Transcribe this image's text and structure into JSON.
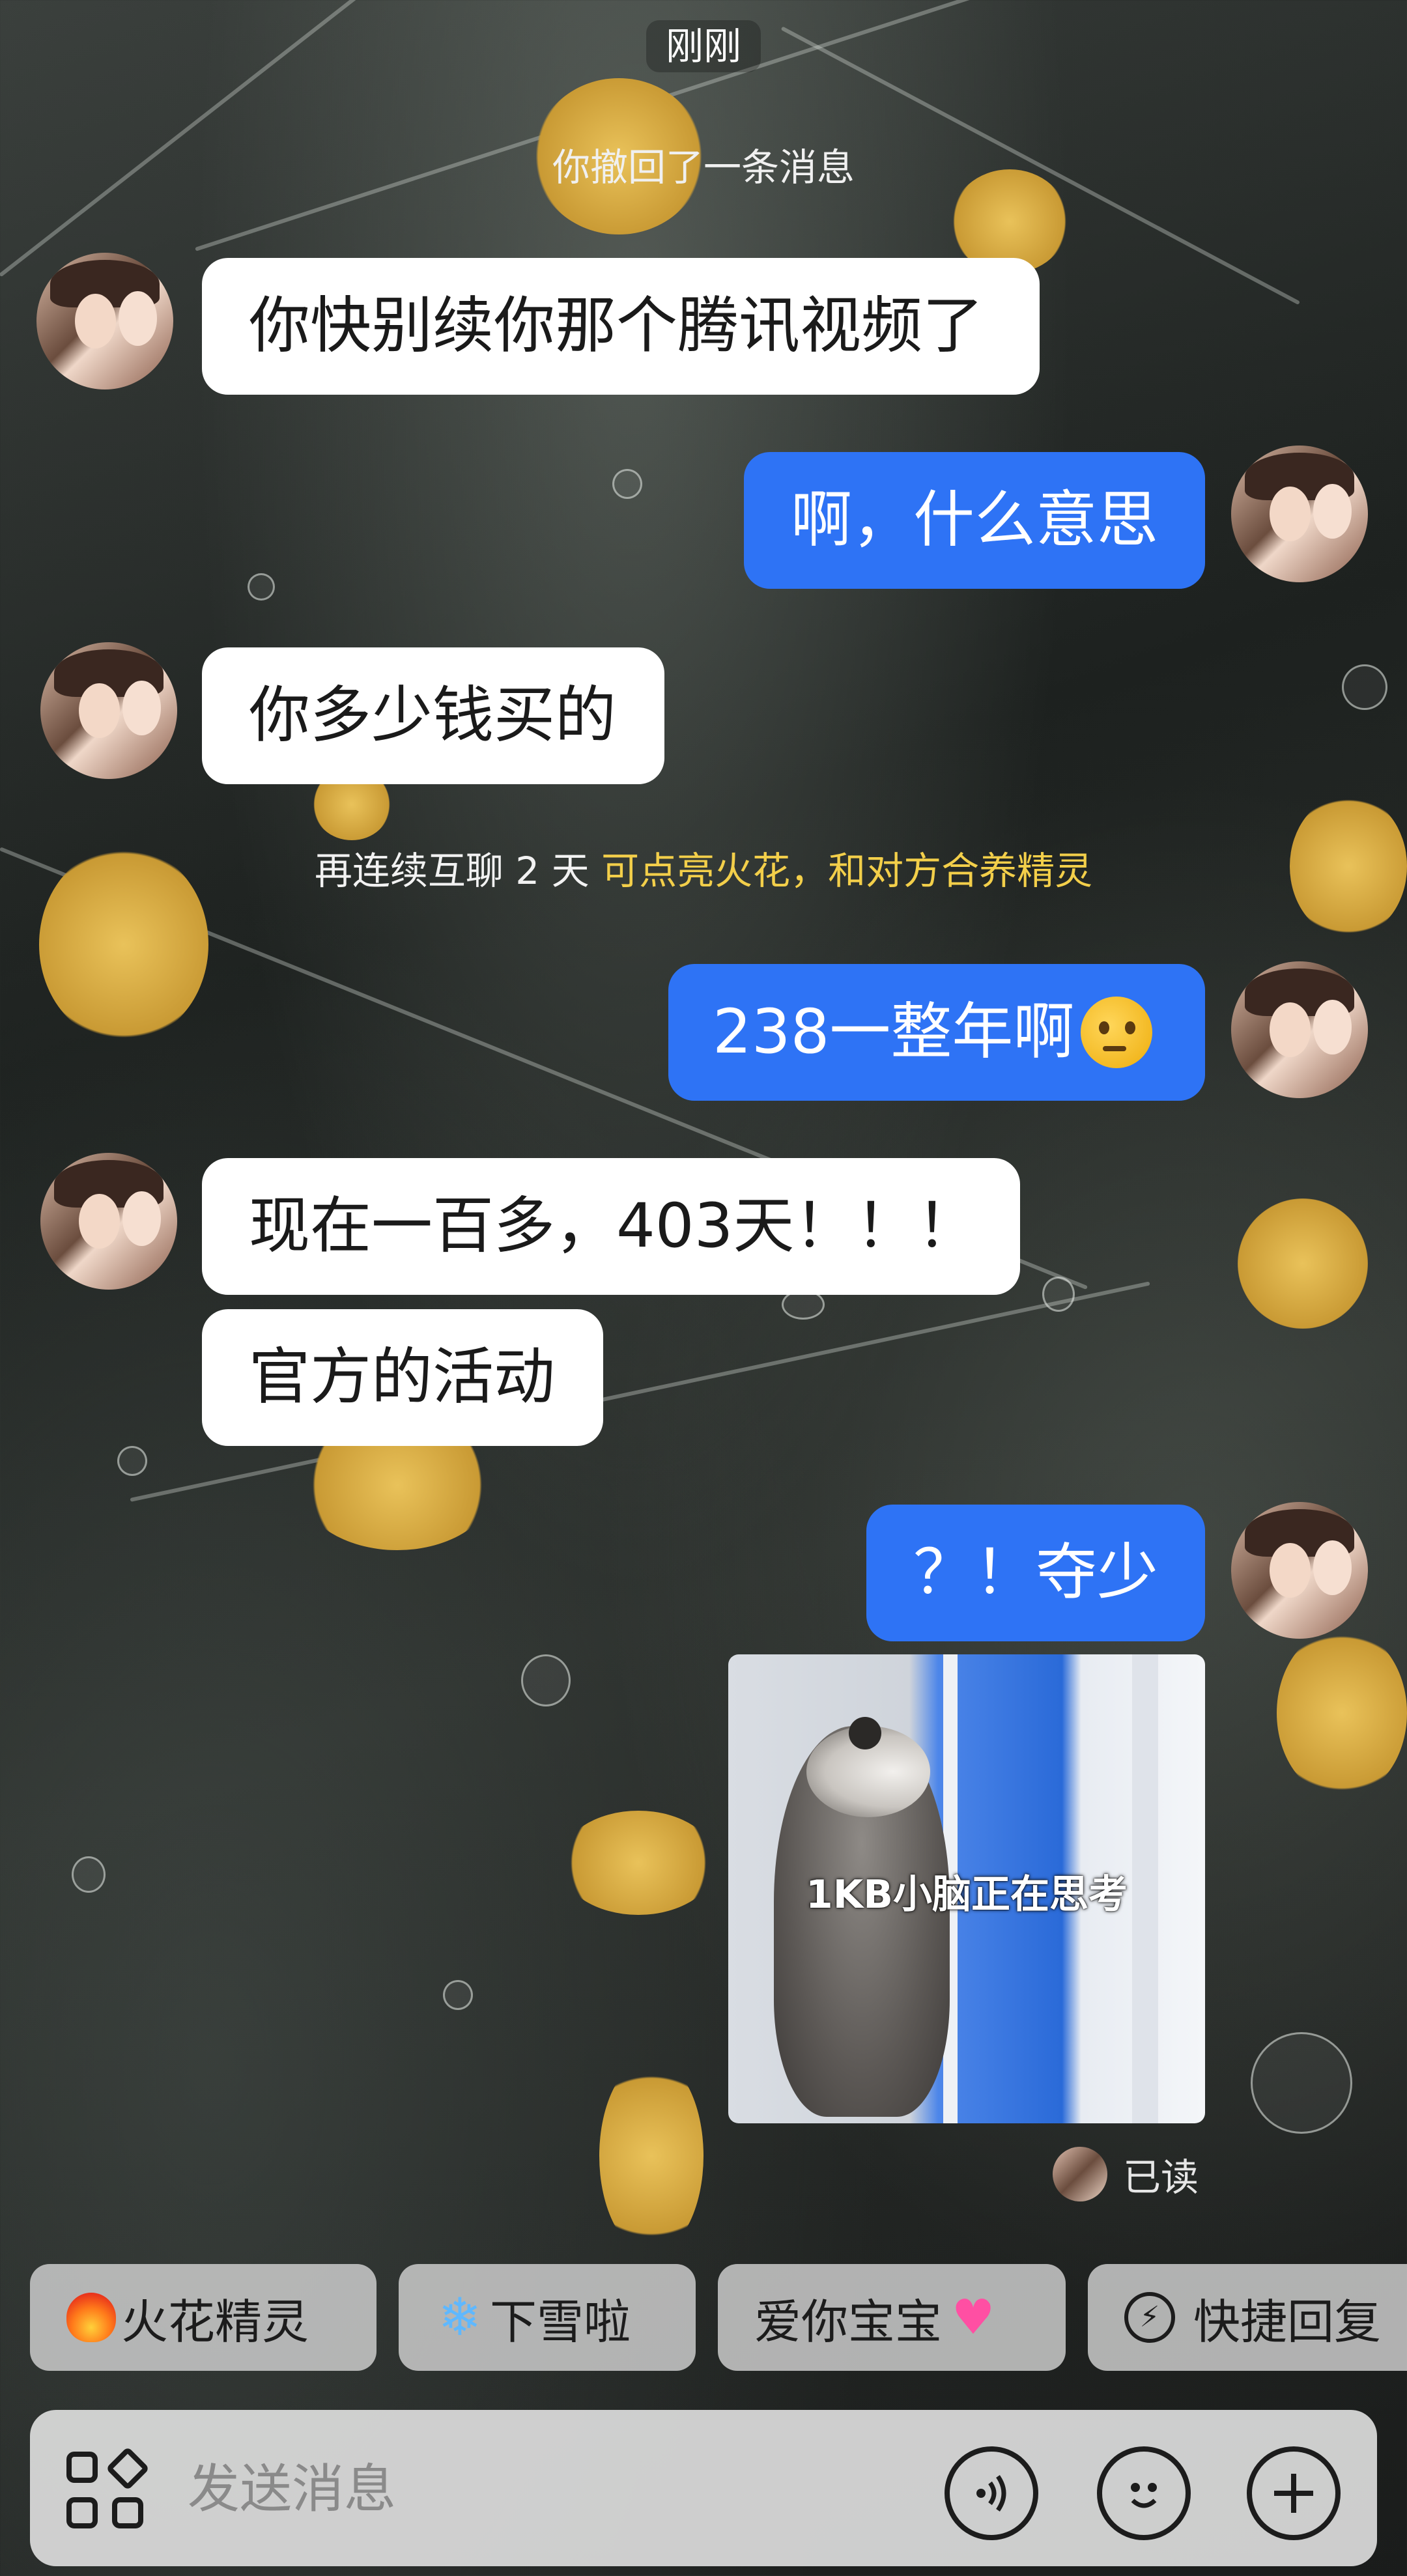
{
  "chat": {
    "time_divider": "刚刚",
    "recall_notice": "你撤回了一条消息",
    "streak_notice": {
      "prefix": "再连续互聊 2 天",
      "highlight": "可点亮火花，和对方合养精灵"
    },
    "messages": [
      {
        "from": "other",
        "text": "你快别续你那个腾讯视频了"
      },
      {
        "from": "me",
        "text": "啊，什么意思"
      },
      {
        "from": "other",
        "text": "你多少钱买的"
      },
      {
        "from": "me",
        "text": "238一整年啊",
        "emoji": "thinking-face"
      },
      {
        "from": "other",
        "text": "现在一百多，403天！！！"
      },
      {
        "from": "other",
        "text": "官方的活动"
      },
      {
        "from": "me",
        "text": "？！夺少"
      },
      {
        "from": "me",
        "type": "sticker",
        "caption": "1KB小脑正在思考"
      }
    ],
    "read_status": "已读"
  },
  "quick_replies": [
    {
      "label": "火花精灵",
      "icon": "fire-icon"
    },
    {
      "label": "下雪啦",
      "icon": "snowflake-icon"
    },
    {
      "label": "爱你宝宝",
      "icon": "hearts-icon"
    },
    {
      "label": "快捷回复",
      "icon": "quick-reply-icon"
    }
  ],
  "composer": {
    "placeholder": "发送消息",
    "icons": [
      "apps-icon",
      "voice-icon",
      "emoji-icon",
      "plus-icon"
    ]
  },
  "colors": {
    "outgoing_bubble": "#2e73f5",
    "incoming_bubble": "#ffffff",
    "streak_highlight": "#f3cf4a"
  }
}
